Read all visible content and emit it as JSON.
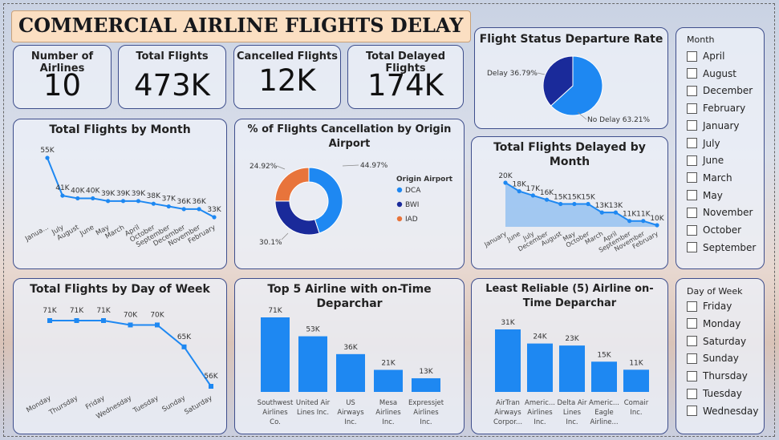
{
  "header": {
    "title": "COMMERCIAL AIRLINE FLIGHTS DELAY"
  },
  "kpis": [
    {
      "label": "Number of Airlines",
      "value": "10"
    },
    {
      "label": "Total Flights",
      "value": "473K"
    },
    {
      "label": "Cancelled Flights",
      "value": "12K"
    },
    {
      "label": "Total Delayed Flights",
      "value": "174K"
    }
  ],
  "titles": {
    "status": "Flight Status Departure Rate",
    "by_month": "Total Flights by Month",
    "cancel": "% of Flights Cancellation by Origin Airport",
    "delayed_month": "Total Flights Delayed by Month",
    "by_dow": "Total Flights by Day of Week",
    "top5": "Top 5 Airline with on-Time Deparchar",
    "least5": "Least Reliable (5) Airline on-Time Deparchar"
  },
  "slicers": {
    "month": {
      "title": "Month",
      "items": [
        "April",
        "August",
        "December",
        "February",
        "January",
        "July",
        "June",
        "March",
        "May",
        "November",
        "October",
        "September"
      ]
    },
    "dow": {
      "title": "Day of Week",
      "items": [
        "Friday",
        "Monday",
        "Saturday",
        "Sunday",
        "Thursday",
        "Tuesday",
        "Wednesday"
      ]
    }
  },
  "chart_data": [
    {
      "type": "pie",
      "title": "Flight Status Departure Rate",
      "slices": [
        {
          "label": "Delay",
          "value": 36.79,
          "display": "Delay 36.79%",
          "color": "#1a2a9a"
        },
        {
          "label": "No Delay",
          "value": 63.21,
          "display": "No Delay 63.21%",
          "color": "#1e88f2"
        }
      ]
    },
    {
      "type": "line",
      "title": "Total Flights by Month",
      "categories": [
        "January",
        "July",
        "August",
        "June",
        "May",
        "March",
        "April",
        "October",
        "September",
        "December",
        "November",
        "February"
      ],
      "tick_labels": [
        "Janua...",
        "July",
        "August",
        "June",
        "May",
        "March",
        "April",
        "October",
        "September",
        "December",
        "November",
        "February"
      ],
      "values": [
        55,
        41,
        40,
        40,
        39,
        39,
        39,
        38,
        37,
        36,
        36,
        33
      ],
      "data_labels": [
        "55K",
        "41K",
        "40K",
        "40K",
        "39K",
        "39K",
        "39K",
        "38K",
        "37K",
        "36K",
        "36K",
        "33K"
      ],
      "unit": "K",
      "color": "#1e88f2"
    },
    {
      "type": "pie",
      "title": "% of Flights Cancellation by Origin Airport",
      "legend_title": "Origin Airport",
      "donut": true,
      "slices": [
        {
          "label": "DCA",
          "value": 44.97,
          "display": "44.97%",
          "color": "#1e88f2"
        },
        {
          "label": "BWI",
          "value": 30.1,
          "display": "30.1%",
          "color": "#1a2a9a"
        },
        {
          "label": "IAD",
          "value": 24.92,
          "display": "24.92%",
          "color": "#e8743b"
        }
      ]
    },
    {
      "type": "area",
      "title": "Total Flights Delayed by Month",
      "categories": [
        "January",
        "June",
        "July",
        "December",
        "August",
        "May",
        "October",
        "March",
        "April",
        "September",
        "November",
        "February"
      ],
      "values": [
        20,
        18,
        17,
        16,
        15,
        15,
        15,
        13,
        13,
        11,
        11,
        10
      ],
      "data_labels": [
        "20K",
        "18K",
        "17K",
        "16K",
        "15K",
        "15K",
        "15K",
        "13K",
        "13K",
        "11K",
        "11K",
        "10K"
      ],
      "unit": "K",
      "color": "#1e88f2"
    },
    {
      "type": "line",
      "title": "Total Flights by Day of Week",
      "categories": [
        "Monday",
        "Thursday",
        "Friday",
        "Wednesday",
        "Tuesday",
        "Sunday",
        "Saturday"
      ],
      "values": [
        71,
        71,
        71,
        70,
        70,
        65,
        56
      ],
      "data_labels": [
        "71K",
        "71K",
        "71K",
        "70K",
        "70K",
        "65K",
        "56K"
      ],
      "unit": "K",
      "color": "#1e88f2"
    },
    {
      "type": "bar",
      "title": "Top 5 Airline with on-Time Deparchar",
      "categories": [
        "Southwest Airlines Co.",
        "United Air Lines Inc.",
        "US Airways Inc.",
        "Mesa Airlines Inc.",
        "Expressjet Airlines Inc."
      ],
      "tick_lines": [
        [
          "Southwest",
          "Airlines",
          "Co."
        ],
        [
          "United Air",
          "Lines Inc."
        ],
        [
          "US",
          "Airways",
          "Inc."
        ],
        [
          "Mesa",
          "Airlines",
          "Inc."
        ],
        [
          "Expressjet",
          "Airlines",
          "Inc."
        ]
      ],
      "values": [
        71,
        53,
        36,
        21,
        13
      ],
      "data_labels": [
        "71K",
        "53K",
        "36K",
        "21K",
        "13K"
      ],
      "unit": "K",
      "color": "#1e88f2"
    },
    {
      "type": "bar",
      "title": "Least Reliable (5) Airline on-Time Deparchar",
      "categories": [
        "AirTran Airways Corpor...",
        "Americ... Airlines Inc.",
        "Delta Air Lines Inc.",
        "Americ... Eagle Airline...",
        "Comair Inc."
      ],
      "tick_lines": [
        [
          "AirTran",
          "Airways",
          "Corpor..."
        ],
        [
          "Americ...",
          "Airlines",
          "Inc."
        ],
        [
          "Delta Air",
          "Lines",
          "Inc."
        ],
        [
          "Americ...",
          "Eagle",
          "Airline..."
        ],
        [
          "Comair",
          "Inc."
        ]
      ],
      "values": [
        31,
        24,
        23,
        15,
        11
      ],
      "data_labels": [
        "31K",
        "24K",
        "23K",
        "15K",
        "11K"
      ],
      "unit": "K",
      "color": "#1e88f2"
    }
  ]
}
